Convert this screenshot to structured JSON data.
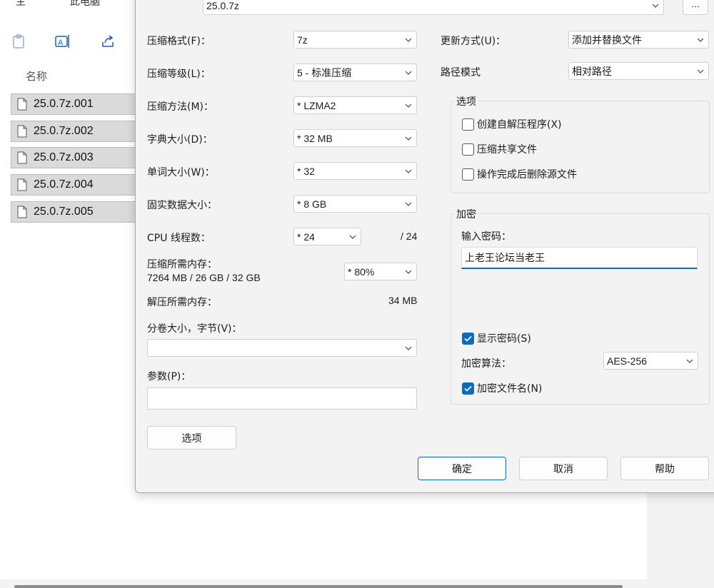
{
  "explorer": {
    "top_stub_left": "主",
    "top_stub_right": "此电脑",
    "column_header": "名称",
    "files": [
      "25.0.7z.001",
      "25.0.7z.002",
      "25.0.7z.003",
      "25.0.7z.004",
      "25.0.7z.005"
    ]
  },
  "dialog": {
    "archive_name": "25.0.7z",
    "browse_label": "...",
    "left": {
      "format_label": "压缩格式(F)：",
      "format_value": "7z",
      "level_label": "压缩等级(L)：",
      "level_value": "5 - 标准压缩",
      "method_label": "压缩方法(M)：",
      "method_value": "* LZMA2",
      "dict_label": "字典大小(D)：",
      "dict_value": "* 32 MB",
      "word_label": "单词大小(W)：",
      "word_value": "* 32",
      "solid_label": "固实数据大小：",
      "solid_value": "* 8 GB",
      "threads_label": "CPU 线程数：",
      "threads_value": "* 24",
      "threads_total": "/ 24",
      "mem_label": "压缩所需内存：",
      "mem_value": "7264 MB / 26 GB / 32 GB",
      "mem_percent": "* 80%",
      "decomp_label": "解压所需内存：",
      "decomp_value": "34 MB",
      "volume_label": "分卷大小，字节(V)：",
      "volume_value": "",
      "params_label": "参数(P)：",
      "params_value": "",
      "options_button": "选项"
    },
    "right": {
      "update_label": "更新方式(U)：",
      "update_value": "添加并替换文件",
      "path_label": "路径模式",
      "path_value": "相对路径",
      "options_group": "选项",
      "opt_sfx": "创建自解压程序(X)",
      "opt_shared": "压缩共享文件",
      "opt_delete": "操作完成后删除源文件",
      "encrypt_group": "加密",
      "password_label": "输入密码：",
      "password_value": "上老王论坛当老王",
      "show_password": "显示密码(S)",
      "algo_label": "加密算法：",
      "algo_value": "AES-256",
      "encrypt_names": "加密文件名(N)"
    },
    "buttons": {
      "ok": "确定",
      "cancel": "取消",
      "help": "帮助"
    }
  },
  "colors": {
    "accent": "#0f6cbd",
    "dialog_bg": "#f3f3f3",
    "selected_row": "#dadada"
  }
}
